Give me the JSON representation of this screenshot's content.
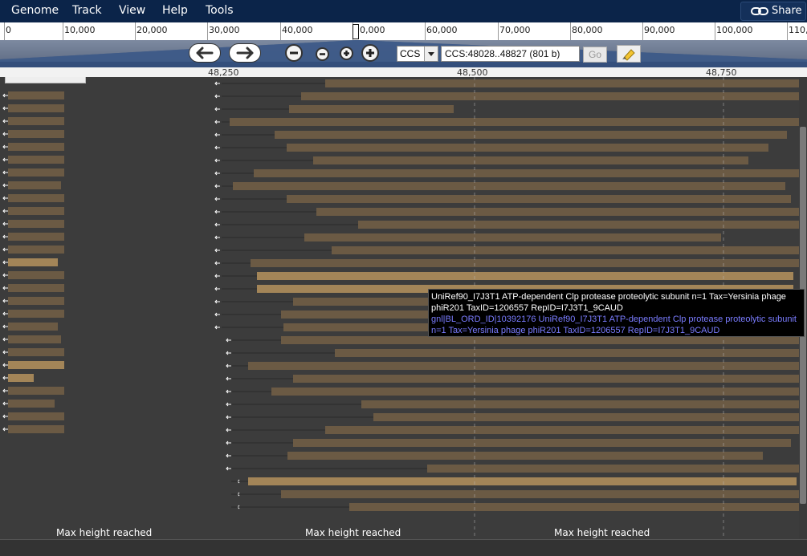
{
  "menubar": {
    "items": [
      "Genome",
      "Track",
      "View",
      "Help",
      "Tools"
    ],
    "share_label": "Share",
    "share_icon": "link-icon"
  },
  "overview": {
    "labels": [
      "0",
      "10,000",
      "20,000",
      "30,000",
      "40,000",
      "50,000",
      "60,000",
      "70,000",
      "80,000",
      "90,000",
      "100,000",
      "110,0"
    ]
  },
  "navbar": {
    "refseq": "CCS",
    "location": "CCS:48028..48827 (801 b)",
    "go_label": "Go",
    "icons": [
      "pan-left-icon",
      "pan-right-icon",
      "zoom-out-large-icon",
      "zoom-out-small-icon",
      "zoom-in-small-icon",
      "zoom-in-large-icon",
      "highlight-icon"
    ]
  },
  "ruler": {
    "labels": [
      "48,250",
      "48,500",
      "48,750"
    ]
  },
  "tracks": {
    "max_height_label": "Max height reached",
    "feature_color": "#6b5a44",
    "highlight_color": "#a38558"
  },
  "tooltip": {
    "line1": "UniRef90_I7J3T1 ATP-dependent Clp protease proteolytic subunit n=1 Tax=Yersinia phage phiR201 TaxID=1206557 RepID=I7J3T1_9CAUD",
    "line2": "gnl|BL_ORD_ID|10392176 UniRef90_I7J3T1 ATP-dependent Clp protease proteolytic subunit n=1 Tax=Yersinia phage phiR201 TaxID=1206557 RepID=I7J3T1_9CAUD"
  }
}
